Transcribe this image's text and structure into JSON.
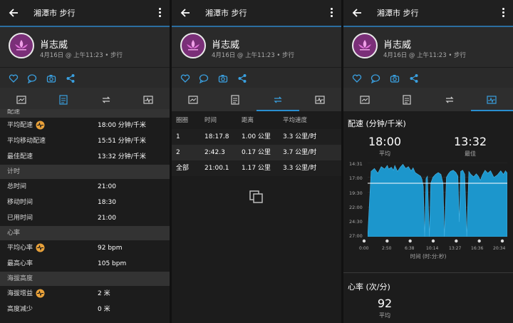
{
  "header": {
    "title": "湘潭市 步行"
  },
  "profile": {
    "name": "肖志威",
    "meta": "4月16日 @ 上午11:23 • 步行"
  },
  "stats": {
    "pace_section": "配速",
    "avg_pace_label": "平均配速",
    "avg_pace_value": "18:00 分钟/千米",
    "avg_moving_pace_label": "平均移动配速",
    "avg_moving_pace_value": "15:51 分钟/千米",
    "best_pace_label": "最佳配速",
    "best_pace_value": "13:32 分钟/千米",
    "time_section": "计时",
    "total_time_label": "总时间",
    "total_time_value": "21:00",
    "moving_time_label": "移动时间",
    "moving_time_value": "18:30",
    "elapsed_time_label": "已用时间",
    "elapsed_time_value": "21:00",
    "hr_section": "心率",
    "avg_hr_label": "平均心率",
    "avg_hr_value": "92 bpm",
    "max_hr_label": "最高心率",
    "max_hr_value": "105 bpm",
    "elev_section": "海拔高度",
    "elev_gain_label": "海拔增益",
    "elev_gain_value": "2 米",
    "elev_loss_label": "高度减少",
    "elev_loss_value": "0 米"
  },
  "laps": {
    "headers": [
      "圈圈",
      "时间",
      "距离",
      "平均速度"
    ],
    "rows": [
      [
        "1",
        "18:17.8",
        "1.00 公里",
        "3.3 公里/时"
      ],
      [
        "2",
        "2:42.3",
        "0.17 公里",
        "3.7 公里/时"
      ],
      [
        "全部",
        "21:00.1",
        "1.17 公里",
        "3.3 公里/时"
      ]
    ]
  },
  "chart": {
    "title": "配速 (分钟/千米)",
    "avg_value": "18:00",
    "avg_label": "平均",
    "best_value": "13:32",
    "best_label": "最佳",
    "x_axis_label": "时间 (时:分:秒)",
    "hr_title": "心率 (次/分)",
    "hr_avg_value": "92",
    "hr_avg_label": "平均"
  },
  "chart_data": {
    "type": "area",
    "xlabel": "时间 (时:分:秒)",
    "ylabel": "配速 (分钟/千米)",
    "x_ticks": [
      "0:00",
      "2:50",
      "6:38",
      "10:14",
      "13:27",
      "16:36",
      "20:34"
    ],
    "y_ticks": [
      "14:31",
      "17:00",
      "19:30",
      "22:00",
      "24:30",
      "27:00"
    ],
    "y_inverted": true,
    "avg_line": "18:00",
    "series": [
      {
        "values": [
          [
            0,
            27.0
          ],
          [
            0.5,
            16.0
          ],
          [
            1.0,
            15.5
          ],
          [
            1.5,
            16.3
          ],
          [
            2.0,
            15.2
          ],
          [
            2.5,
            15.6
          ],
          [
            2.9,
            15.0
          ],
          [
            3.1,
            15.6
          ],
          [
            3.5,
            15.3
          ],
          [
            3.8,
            15.8
          ],
          [
            4.0,
            15.0
          ],
          [
            4.4,
            16.0
          ],
          [
            4.8,
            15.3
          ],
          [
            5.2,
            14.8
          ],
          [
            5.6,
            15.5
          ],
          [
            6.0,
            15.2
          ],
          [
            6.4,
            15.9
          ],
          [
            6.7,
            15.4
          ],
          [
            7.0,
            16.2
          ],
          [
            7.4,
            16.5
          ],
          [
            7.8,
            16.8
          ],
          [
            8.0,
            17.3
          ],
          [
            8.2,
            18.5
          ],
          [
            8.4,
            27.0
          ],
          [
            8.6,
            17.2
          ],
          [
            8.8,
            16.8
          ],
          [
            9.1,
            27.0
          ],
          [
            9.3,
            18.0
          ],
          [
            9.6,
            17.0
          ],
          [
            10.0,
            16.5
          ],
          [
            10.4,
            16.2
          ],
          [
            10.8,
            16.5
          ],
          [
            11.1,
            18.0
          ],
          [
            11.3,
            27.0
          ],
          [
            11.6,
            17.0
          ],
          [
            11.9,
            16.4
          ],
          [
            12.2,
            16.0
          ],
          [
            12.6,
            15.8
          ],
          [
            13.0,
            16.2
          ],
          [
            13.3,
            16.8
          ],
          [
            13.5,
            24.5
          ],
          [
            13.7,
            16.0
          ],
          [
            14.0,
            15.8
          ],
          [
            14.3,
            16.5
          ],
          [
            14.6,
            27.0
          ],
          [
            14.9,
            16.0
          ],
          [
            15.2,
            16.5
          ],
          [
            15.6,
            16.9
          ],
          [
            16.0,
            16.4
          ],
          [
            16.3,
            16.8
          ],
          [
            16.6,
            17.5
          ],
          [
            16.9,
            16.6
          ],
          [
            17.3,
            15.8
          ],
          [
            17.7,
            16.3
          ],
          [
            18.1,
            15.9
          ],
          [
            18.6,
            17.0
          ],
          [
            19.1,
            16.6
          ],
          [
            19.6,
            15.9
          ],
          [
            20.0,
            16.5
          ],
          [
            20.3,
            15.9
          ],
          [
            20.57,
            16.3
          ]
        ]
      }
    ]
  },
  "colors": {
    "accent": "#2a8fd0",
    "chart_fill": "#1c96cc",
    "avatar_bg": "#7a2f78"
  }
}
